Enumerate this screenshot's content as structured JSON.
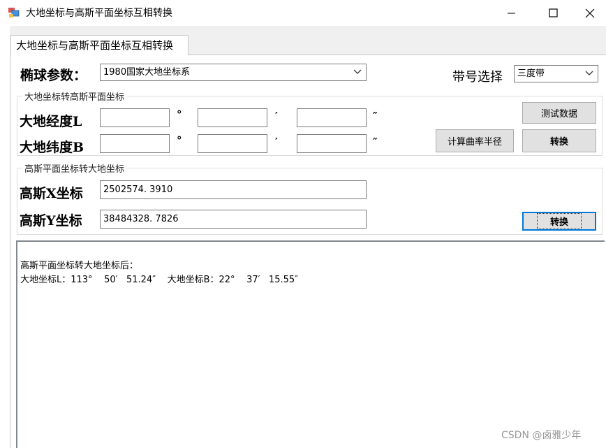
{
  "window": {
    "title": "大地坐标与高斯平面坐标互相转换"
  },
  "tab": {
    "label": "大地坐标与高斯平面坐标互相转换"
  },
  "ellipsoid": {
    "label": "椭球参数：",
    "selected": "1980国家大地坐标系"
  },
  "zone": {
    "label": "带号选择",
    "selected": "三度带"
  },
  "geo_to_gauss": {
    "group_title": "大地坐标转高斯平面坐标",
    "longitude_label": "大地经度L",
    "latitude_label": "大地纬度B",
    "degree_symbol": "°",
    "minute_symbol": "′",
    "second_symbol": "″",
    "lon_deg": "",
    "lon_min": "",
    "lon_sec": "",
    "lat_deg": "",
    "lat_min": "",
    "lat_sec": "",
    "test_button": "测试数据",
    "radius_button": "计算曲率半径",
    "convert_button": "转换"
  },
  "gauss_to_geo": {
    "group_title": "高斯平面坐标转大地坐标",
    "x_label": "高斯X坐标",
    "y_label": "高斯Y坐标",
    "x_value": "2502574. 3910",
    "y_value": "38484328. 7826",
    "convert_button": "转换"
  },
  "output": {
    "line1": "高斯平面坐标转大地坐标后：",
    "line2": "大地坐标L：113°    50′   51.24″    大地坐标B：22°    37′   15.55″"
  },
  "watermark": "CSDN @卤雅少年",
  "colors": {
    "accent_focus": "#0078d7",
    "button_face": "#e1e1e1",
    "window_bg": "#f0f0f0"
  }
}
